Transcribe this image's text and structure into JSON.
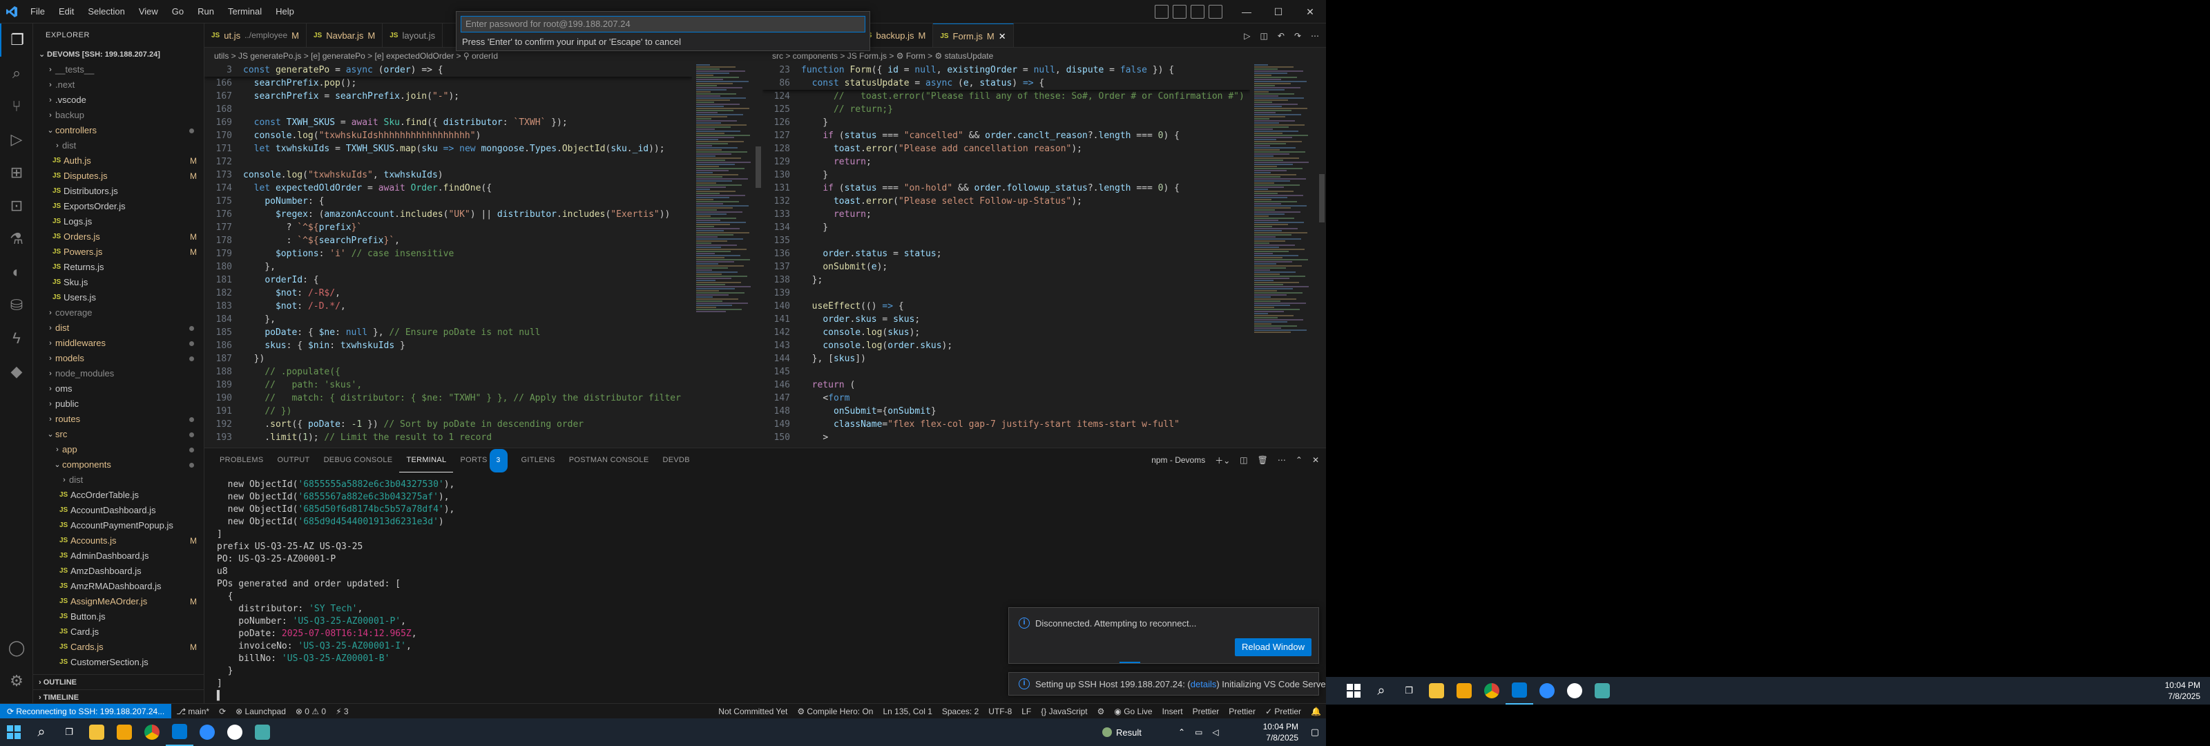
{
  "title_bar": {
    "menu": [
      "File",
      "Edit",
      "Selection",
      "View",
      "Go",
      "Run",
      "Terminal",
      "Help"
    ]
  },
  "command_prompt": {
    "placeholder": "Enter password for root@199.188.207.24",
    "hint": "Press 'Enter' to confirm your input or 'Escape' to cancel"
  },
  "explorer": {
    "header": "EXPLORER",
    "root": "DEVOMS [SSH: 199.188.207.24]",
    "items": [
      {
        "label": "__tests__",
        "type": "folder",
        "depth": 1,
        "open": false,
        "cls": "c-git"
      },
      {
        "label": ".next",
        "type": "folder",
        "depth": 1,
        "open": false,
        "cls": "c-git"
      },
      {
        "label": ".vscode",
        "type": "folder",
        "depth": 1,
        "open": false,
        "cls": ""
      },
      {
        "label": "backup",
        "type": "folder",
        "depth": 1,
        "open": false,
        "cls": "c-git"
      },
      {
        "label": "controllers",
        "type": "folder",
        "depth": 1,
        "open": true,
        "cls": "c-mod",
        "dot": true
      },
      {
        "label": "dist",
        "type": "folder",
        "depth": 2,
        "open": false,
        "cls": "c-git"
      },
      {
        "label": "Auth.js",
        "type": "file",
        "depth": 2,
        "cls": "c-mod",
        "mark": "M"
      },
      {
        "label": "Disputes.js",
        "type": "file",
        "depth": 2,
        "cls": "c-mod",
        "mark": "M"
      },
      {
        "label": "Distributors.js",
        "type": "file",
        "depth": 2,
        "cls": ""
      },
      {
        "label": "ExportsOrder.js",
        "type": "file",
        "depth": 2,
        "cls": ""
      },
      {
        "label": "Logs.js",
        "type": "file",
        "depth": 2,
        "cls": ""
      },
      {
        "label": "Orders.js",
        "type": "file",
        "depth": 2,
        "cls": "c-mod",
        "mark": "M"
      },
      {
        "label": "Powers.js",
        "type": "file",
        "depth": 2,
        "cls": "c-mod",
        "mark": "M"
      },
      {
        "label": "Returns.js",
        "type": "file",
        "depth": 2,
        "cls": ""
      },
      {
        "label": "Sku.js",
        "type": "file",
        "depth": 2,
        "cls": ""
      },
      {
        "label": "Users.js",
        "type": "file",
        "depth": 2,
        "cls": ""
      },
      {
        "label": "coverage",
        "type": "folder",
        "depth": 1,
        "open": false,
        "cls": "c-git"
      },
      {
        "label": "dist",
        "type": "folder",
        "depth": 1,
        "open": false,
        "cls": "c-mod",
        "dot": true
      },
      {
        "label": "middlewares",
        "type": "folder",
        "depth": 1,
        "open": false,
        "cls": "c-mod",
        "dot": true
      },
      {
        "label": "models",
        "type": "folder",
        "depth": 1,
        "open": false,
        "cls": "c-mod",
        "dot": true
      },
      {
        "label": "node_modules",
        "type": "folder",
        "depth": 1,
        "open": false,
        "cls": "c-git"
      },
      {
        "label": "oms",
        "type": "folder",
        "depth": 1,
        "open": false,
        "cls": ""
      },
      {
        "label": "public",
        "type": "folder",
        "depth": 1,
        "open": false,
        "cls": ""
      },
      {
        "label": "routes",
        "type": "folder",
        "depth": 1,
        "open": false,
        "cls": "c-mod",
        "dot": true
      },
      {
        "label": "src",
        "type": "folder",
        "depth": 1,
        "open": true,
        "cls": "c-mod",
        "dot": true
      },
      {
        "label": "app",
        "type": "folder",
        "depth": 2,
        "open": false,
        "cls": "c-mod",
        "dot": true
      },
      {
        "label": "components",
        "type": "folder",
        "depth": 2,
        "open": true,
        "cls": "c-mod",
        "dot": true
      },
      {
        "label": "dist",
        "type": "folder",
        "depth": 3,
        "open": false,
        "cls": "c-git"
      },
      {
        "label": "AccOrderTable.js",
        "type": "file",
        "depth": 3,
        "cls": ""
      },
      {
        "label": "AccountDashboard.js",
        "type": "file",
        "depth": 3,
        "cls": ""
      },
      {
        "label": "AccountPaymentPopup.js",
        "type": "file",
        "depth": 3,
        "cls": ""
      },
      {
        "label": "Accounts.js",
        "type": "file",
        "depth": 3,
        "cls": "c-mod",
        "mark": "M"
      },
      {
        "label": "AdminDashboard.js",
        "type": "file",
        "depth": 3,
        "cls": ""
      },
      {
        "label": "AmzDashboard.js",
        "type": "file",
        "depth": 3,
        "cls": ""
      },
      {
        "label": "AmzRMADashboard.js",
        "type": "file",
        "depth": 3,
        "cls": ""
      },
      {
        "label": "AssignMeAOrder.js",
        "type": "file",
        "depth": 3,
        "cls": "c-mod",
        "mark": "M"
      },
      {
        "label": "Button.js",
        "type": "file",
        "depth": 3,
        "cls": ""
      },
      {
        "label": "Card.js",
        "type": "file",
        "depth": 3,
        "cls": ""
      },
      {
        "label": "Cards.js",
        "type": "file",
        "depth": 3,
        "cls": "c-mod",
        "mark": "M"
      },
      {
        "label": "CustomerSection.js",
        "type": "file",
        "depth": 3,
        "cls": ""
      }
    ],
    "outline": "OUTLINE",
    "timeline": "TIMELINE"
  },
  "tabs_left": [
    {
      "label": "ut.js",
      "path": "../employee",
      "mark": "M",
      "active": false
    },
    {
      "label": "Navbar.js",
      "path": "",
      "mark": "M",
      "active": false
    },
    {
      "label": "layout.js",
      "path": "",
      "mark": "",
      "active": false
    }
  ],
  "tabs_right": [
    {
      "label": "generatePo.js",
      "path": "",
      "mark": "M",
      "active": false
    },
    {
      "label": "backup.js",
      "path": "",
      "mark": "M",
      "active": false
    },
    {
      "label": "Form.js",
      "path": "",
      "mark": "M",
      "active": true
    }
  ],
  "breadcrumb_left": "utils > JS generatePo.js > [e] generatePo > [e] expectedOldOrder > ⚲ orderId",
  "breadcrumb_right": "src > components > JS Form.js > ⚙ Form > ⚙ statusUpdate",
  "editor_left": {
    "sticky": [
      {
        "n": "3",
        "html": "<span class='k'>const</span> <span class='f'>generatePo</span> <span class='p'>=</span> <span class='k'>async</span> <span class='p'>(</span><span class='v'>order</span><span class='p'>) =&gt; {</span>"
      }
    ],
    "lines": [
      {
        "n": "166",
        "html": "  <span class='v'>searchPrefix</span>.<span class='f'>pop</span>();"
      },
      {
        "n": "167",
        "html": "  <span class='v'>searchPrefix</span> = <span class='v'>searchPrefix</span>.<span class='f'>join</span>(<span class='s'>\"-\"</span>);"
      },
      {
        "n": "168",
        "html": ""
      },
      {
        "n": "169",
        "html": "  <span class='k'>const</span> <span class='v'>TXWH_SKUS</span> = <span class='kw'>await</span> <span class='t'>Sku</span>.<span class='f'>find</span>({ <span class='v'>distributor</span>: <span class='s'>`TXWH`</span> });"
      },
      {
        "n": "170",
        "html": "  <span class='v'>console</span>.<span class='f'>log</span>(<span class='s'>\"txwhskuIdshhhhhhhhhhhhhhhhh\"</span>)"
      },
      {
        "n": "171",
        "html": "  <span class='k'>let</span> <span class='v'>txwhskuIds</span> = <span class='v'>TXWH_SKUS</span>.<span class='f'>map</span>(<span class='v'>sku</span> <span class='k'>=&gt;</span> <span class='k'>new</span> <span class='v'>mongoose</span>.<span class='v'>Types</span>.<span class='f'>ObjectId</span>(<span class='v'>sku</span>.<span class='v'>_id</span>));"
      },
      {
        "n": "172",
        "html": ""
      },
      {
        "n": "173",
        "html": "<span class='v'>console</span>.<span class='f'>log</span>(<span class='s'>\"txwhskuIds\"</span>, <span class='v'>txwhskuIds</span>)"
      },
      {
        "n": "174",
        "html": "  <span class='k'>let</span> <span class='v'>expectedOldOrder</span> = <span class='kw'>await</span> <span class='t'>Order</span>.<span class='f'>findOne</span>({"
      },
      {
        "n": "175",
        "html": "    <span class='v'>poNumber</span>: {"
      },
      {
        "n": "176",
        "html": "      <span class='v'>$regex</span>: (<span class='v'>amazonAccount</span>.<span class='f'>includes</span>(<span class='s'>\"UK\"</span>) || <span class='v'>distributor</span>.<span class='f'>includes</span>(<span class='s'>\"Exertis\"</span>))"
      },
      {
        "n": "177",
        "html": "        ? <span class='s'>`^${</span><span class='v'>prefix</span><span class='s'>}`</span>"
      },
      {
        "n": "178",
        "html": "        : <span class='s'>`^${</span><span class='v'>searchPrefix</span><span class='s'>}`</span>,"
      },
      {
        "n": "179",
        "html": "      <span class='v'>$options</span>: <span class='s'>'i'</span> <span class='c'>// case insensitive</span>"
      },
      {
        "n": "180",
        "html": "    },"
      },
      {
        "n": "181",
        "html": "    <span class='v'>orderId</span>: {"
      },
      {
        "n": "182",
        "html": "      <span class='v'>$not</span>: <span class='r'>/-R$/</span>,"
      },
      {
        "n": "183",
        "html": "      <span class='v'>$not</span>: <span class='r'>/-D.*/</span>,"
      },
      {
        "n": "184",
        "html": "    },"
      },
      {
        "n": "185",
        "html": "    <span class='v'>poDate</span>: { <span class='v'>$ne</span>: <span class='k'>null</span> }, <span class='c'>// Ensure poDate is not null</span>"
      },
      {
        "n": "186",
        "html": "    <span class='v'>skus</span>: { <span class='v'>$nin</span>: <span class='v'>txwhskuIds</span> }"
      },
      {
        "n": "187",
        "html": "  })"
      },
      {
        "n": "188",
        "html": "    <span class='c'>// .populate({</span>"
      },
      {
        "n": "189",
        "html": "    <span class='c'>//   path: 'skus',</span>"
      },
      {
        "n": "190",
        "html": "    <span class='c'>//   match: { distributor: { $ne: \"TXWH\" } }, // Apply the distributor filter</span>"
      },
      {
        "n": "191",
        "html": "    <span class='c'>// })</span>"
      },
      {
        "n": "192",
        "html": "    .<span class='f'>sort</span>({ <span class='v'>poDate</span>: <span class='n'>-1</span> }) <span class='c'>// Sort by poDate in descending order</span>"
      },
      {
        "n": "193",
        "html": "    .<span class='f'>limit</span>(<span class='n'>1</span>); <span class='c'>// Limit the result to 1 record</span>"
      }
    ]
  },
  "editor_right": {
    "sticky": [
      {
        "n": "23",
        "html": "<span class='k'>function</span> <span class='f'>Form</span>({ <span class='v'>id</span> = <span class='k'>null</span>, <span class='v'>existingOrder</span> = <span class='k'>null</span>, <span class='v'>dispute</span> = <span class='k'>false</span> }) {"
      },
      {
        "n": "86",
        "html": "  <span class='k'>const</span> <span class='f'>statusUpdate</span> = <span class='k'>async</span> (<span class='v'>e</span>, <span class='v'>status</span>) <span class='k'>=&gt;</span> {"
      }
    ],
    "lines": [
      {
        "n": "124",
        "html": "      <span class='c'>//   toast.error(\"Please fill any of these: So#, Order # or Confirmation #\")</span>"
      },
      {
        "n": "125",
        "html": "      <span class='c'>// return;}</span>"
      },
      {
        "n": "126",
        "html": "    }"
      },
      {
        "n": "127",
        "html": "    <span class='kw'>if</span> (<span class='v'>status</span> === <span class='s'>\"cancelled\"</span> &amp;&amp; <span class='v'>order</span>.<span class='v'>canclt_reason</span>?.<span class='v'>length</span> === <span class='n'>0</span>) {"
      },
      {
        "n": "128",
        "html": "      <span class='v'>toast</span>.<span class='f'>error</span>(<span class='s'>\"Please add cancellation reason\"</span>);"
      },
      {
        "n": "129",
        "html": "      <span class='kw'>return</span>;"
      },
      {
        "n": "130",
        "html": "    }"
      },
      {
        "n": "131",
        "html": "    <span class='kw'>if</span> (<span class='v'>status</span> === <span class='s'>\"on-hold\"</span> &amp;&amp; <span class='v'>order</span>.<span class='v'>followup_status</span>?.<span class='v'>length</span> === <span class='n'>0</span>) {"
      },
      {
        "n": "132",
        "html": "      <span class='v'>toast</span>.<span class='f'>error</span>(<span class='s'>\"Please select Follow-up-Status\"</span>);"
      },
      {
        "n": "133",
        "html": "      <span class='kw'>return</span>;"
      },
      {
        "n": "134",
        "html": "    }"
      },
      {
        "n": "135",
        "html": ""
      },
      {
        "n": "136",
        "html": "    <span class='v'>order</span>.<span class='v'>status</span> = <span class='v'>status</span>;"
      },
      {
        "n": "137",
        "html": "    <span class='f'>onSubmit</span>(<span class='v'>e</span>);"
      },
      {
        "n": "138",
        "html": "  };"
      },
      {
        "n": "139",
        "html": ""
      },
      {
        "n": "140",
        "html": "  <span class='f'>useEffect</span>(() <span class='k'>=&gt;</span> {"
      },
      {
        "n": "141",
        "html": "    <span class='v'>order</span>.<span class='v'>skus</span> = <span class='v'>skus</span>;"
      },
      {
        "n": "142",
        "html": "    <span class='v'>console</span>.<span class='f'>log</span>(<span class='v'>skus</span>);"
      },
      {
        "n": "143",
        "html": "    <span class='v'>console</span>.<span class='f'>log</span>(<span class='v'>order</span>.<span class='v'>skus</span>);"
      },
      {
        "n": "144",
        "html": "  }, [<span class='v'>skus</span>])"
      },
      {
        "n": "145",
        "html": ""
      },
      {
        "n": "146",
        "html": "  <span class='kw'>return</span> ("
      },
      {
        "n": "147",
        "html": "    <span class='p'>&lt;</span><span class='k'>form</span>"
      },
      {
        "n": "148",
        "html": "      <span class='v'>onSubmit</span>={<span class='v'>onSubmit</span>}"
      },
      {
        "n": "149",
        "html": "      <span class='v'>className</span>=<span class='s'>\"flex flex-col gap-7 justify-start items-start w-full\"</span>"
      },
      {
        "n": "150",
        "html": "    <span class='p'>&gt;</span>"
      }
    ]
  },
  "panel": {
    "tabs": [
      "PROBLEMS",
      "OUTPUT",
      "DEBUG CONSOLE",
      "TERMINAL",
      "PORTS",
      "GITLENS",
      "POSTMAN CONSOLE",
      "DEVDB"
    ],
    "ports_badge": "3",
    "terminal_name": "npm - Devoms",
    "terminal_lines": [
      {
        "html": "  new ObjectId(<span class='s' style='color:#2aa198'>'6855555a5882e6c3b04327530'</span>),"
      },
      {
        "html": "  new ObjectId(<span class='s' style='color:#2aa198'>'6855567a882e6c3b043275af'</span>),"
      },
      {
        "html": "  new ObjectId(<span class='s' style='color:#2aa198'>'685d50f6d8174bc5b57a78df4'</span>),"
      },
      {
        "html": "  new ObjectId(<span class='s' style='color:#2aa198'>'685d9d4544001913d6231e3d'</span>)"
      },
      {
        "html": "]"
      },
      {
        "html": "prefix US-Q3-25-AZ US-Q3-25"
      },
      {
        "html": "PO: US-Q3-25-AZ00001-P"
      },
      {
        "html": "u8"
      },
      {
        "html": "POs generated and order updated: ["
      },
      {
        "html": "  {"
      },
      {
        "html": "    distributor: <span style='color:#2aa198'>'SY Tech'</span>,"
      },
      {
        "html": "    poNumber: <span style='color:#2aa198'>'US-Q3-25-AZ00001-P'</span>,"
      },
      {
        "html": "    poDate: <span style='color:#d33682'>2025-07-08T16:14:12.965Z</span>,"
      },
      {
        "html": "    invoiceNo: <span style='color:#2aa198'>'US-Q3-25-AZ00001-I'</span>,"
      },
      {
        "html": "    billNo: <span style='color:#2aa198'>'US-Q3-25-AZ00001-B'</span>"
      },
      {
        "html": "  }"
      },
      {
        "html": "]"
      },
      {
        "html": "▌"
      }
    ]
  },
  "notifications": {
    "disconnected": "Disconnected. Attempting to reconnect...",
    "reload": "Reload Window",
    "ssh_prefix": "Setting up SSH Host 199.188.207.24: (",
    "ssh_link": "details",
    "ssh_suffix": ") Initializing VS Code Server"
  },
  "status_bar": {
    "remote": "⟳ Reconnecting to SSH: 199.188.207.24...",
    "left": [
      "⎇ main*",
      "⟳",
      "⊗ Launchpad",
      "⊗ 0 ⚠ 0",
      "⚡ 3"
    ],
    "right": [
      "Not Committed Yet",
      "⚙ Compile Hero: On",
      "Ln 135, Col 1",
      "Spaces: 2",
      "UTF-8",
      "LF",
      "{} JavaScript",
      "⚙",
      "◉ Go Live",
      "Insert",
      "Prettier",
      "Prettier",
      "✓ Prettier",
      "🔔"
    ]
  },
  "taskbar_left": {
    "result_label": "Result"
  },
  "clock": {
    "time": "10:04 PM",
    "date": "7/8/2025"
  },
  "clock2": {
    "time": "10:04 PM",
    "date": "7/8/2025"
  }
}
